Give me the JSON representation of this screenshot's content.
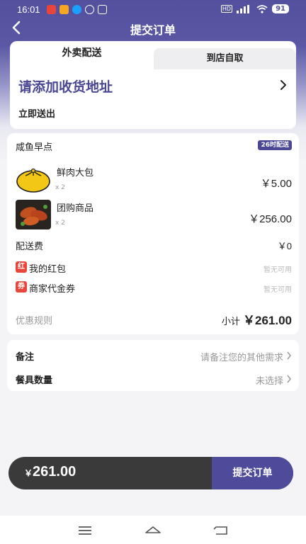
{
  "status_bar": {
    "time": "16:01",
    "battery": "91"
  },
  "header": {
    "title": "提交订单"
  },
  "delivery": {
    "tabs": [
      {
        "label": "外卖配送"
      },
      {
        "label": "到店自取"
      }
    ],
    "address_prompt": "请添加收货地址",
    "delivery_time": "立即送出"
  },
  "order": {
    "shop_name": "咸鱼早点",
    "time_badge": "26时配送",
    "items": [
      {
        "name": "鲜肉大包",
        "qty": "x 2",
        "price": "￥5.00"
      },
      {
        "name": "团购商品",
        "qty": "x 2",
        "price": "￥256.00"
      }
    ],
    "delivery_fee": {
      "label": "配送费",
      "value": "￥0"
    },
    "red_packet": {
      "tag": "红",
      "label": "我的红包",
      "value": "暂无可用"
    },
    "voucher": {
      "tag": "券",
      "label": "商家代金券",
      "value": "暂无可用"
    },
    "rules_label": "优惠规则",
    "subtotal_label": "小计",
    "subtotal_amount": "￥261.00"
  },
  "notes": {
    "remark": {
      "label": "备注",
      "value": "请备注您的其他需求"
    },
    "tableware": {
      "label": "餐具数量",
      "value": "未选择"
    }
  },
  "footer": {
    "currency": "￥",
    "total": "261.00",
    "submit_label": "提交订单"
  },
  "colors": {
    "brand": "#4d4b9a",
    "red_tag": "#e8453c"
  },
  "icons": [
    "back-arrow-icon",
    "chevron-right-icon",
    "menu-icon",
    "home-icon",
    "back-icon"
  ]
}
